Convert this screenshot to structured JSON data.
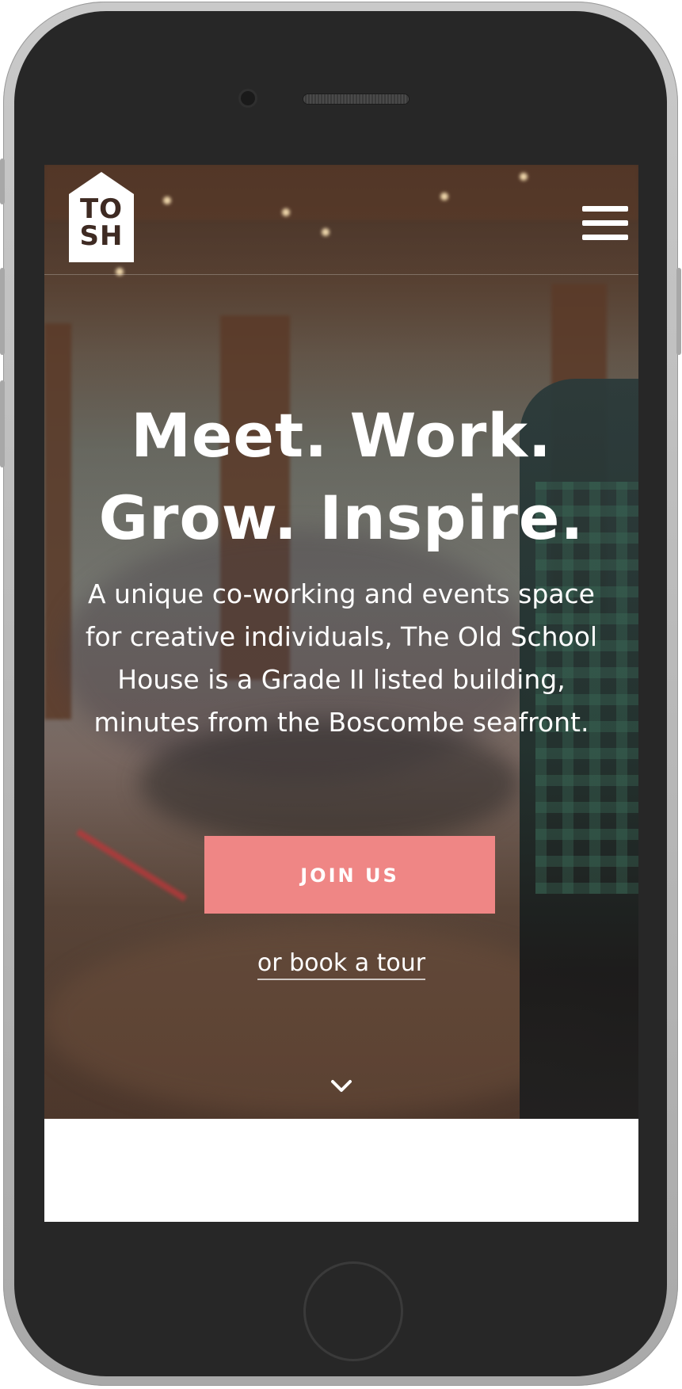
{
  "brand": {
    "logo_text_top": "TO",
    "logo_text_bottom": "SH",
    "logo_color": "#3e2a22"
  },
  "header": {
    "menu_icon": "hamburger-menu-icon"
  },
  "hero": {
    "headline_line1": "Meet. Work.",
    "headline_line2": "Grow. Inspire.",
    "description": "A unique co-working and events space for creative individuals, The Old School House is a Grade II listed building, minutes from the Boscombe seafront.",
    "join_label": "JOIN US",
    "tour_label": "or book a tour",
    "scroll_icon": "chevron-down-icon"
  },
  "colors": {
    "accent": "#ef8685",
    "text_on_hero": "#ffffff",
    "device_frame": "#272727"
  }
}
